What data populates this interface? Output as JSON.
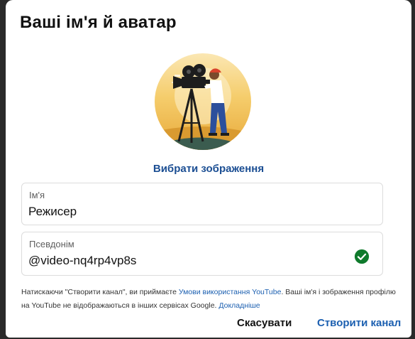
{
  "dialog": {
    "title": "Ваші ім'я й аватар",
    "pick_image_label": "Вибрати зображення",
    "name_field": {
      "label": "Ім'я",
      "value": "Режисер"
    },
    "handle_field": {
      "label": "Псевдонім",
      "value": "@video-nq4rp4vp8s",
      "status_icon": "check-circle-icon",
      "status_color": "#0f7a2c"
    },
    "legal": {
      "part1": "Натискаючи \"Створити канал\", ви приймаєте ",
      "terms_link": "Умови використання YouTube",
      "part2": ". Ваші ім'я і зображення профілю на YouTube не відображаються в інших сервісах Google. ",
      "learn_more_link": "Докладніше"
    },
    "cancel_label": "Скасувати",
    "create_label": "Створити канал"
  },
  "colors": {
    "accent": "#1b5fb0",
    "avatar_bg": "#f2c35a"
  }
}
